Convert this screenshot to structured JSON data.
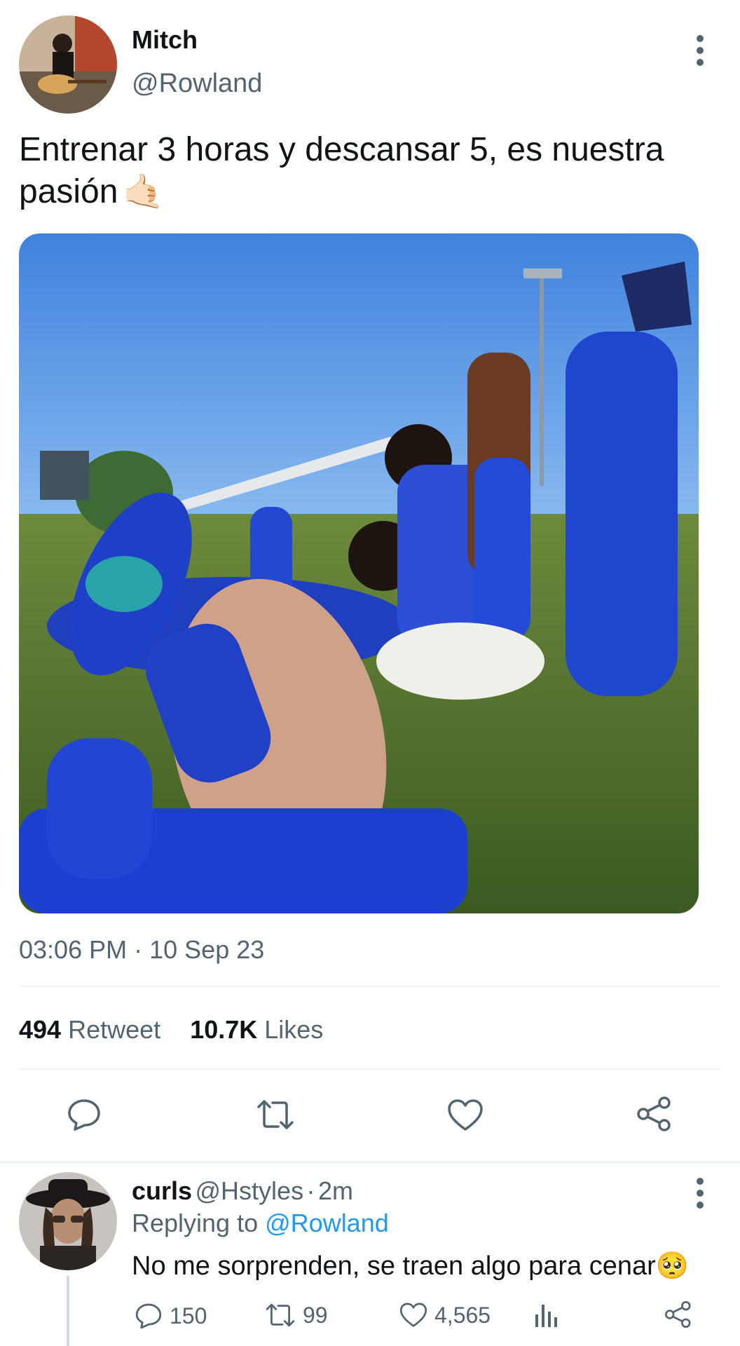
{
  "tweet": {
    "author_name": "Mitch",
    "author_handle": "@Rowland",
    "text": "Entrenar 3 horas y descansar 5, es nuestra pasión",
    "emoji": "🤙🏻",
    "time": "03:06 PM",
    "separator": "·",
    "date": "10 Sep 23",
    "retweets_count": "494",
    "retweets_label": "Retweet",
    "likes_count": "10.7K",
    "likes_label": "Likes",
    "actions": [
      "reply-icon",
      "retweet-icon",
      "like-icon",
      "share-icon"
    ]
  },
  "reply": {
    "author_name": "curls",
    "author_handle": "@Hstyles",
    "separator": "·",
    "age": "2m",
    "replying_label": "Replying to",
    "replying_handle": "@Rowland",
    "text": "No me sorprenden, se traen algo para cenar",
    "emoji": "🥺",
    "reply_count": "150",
    "retweet_count": "99",
    "like_count": "4,565"
  },
  "colors": {
    "text_primary": "#0f1419",
    "text_secondary": "#536471",
    "link": "#1d9bf0",
    "divider": "#eff3f4"
  }
}
